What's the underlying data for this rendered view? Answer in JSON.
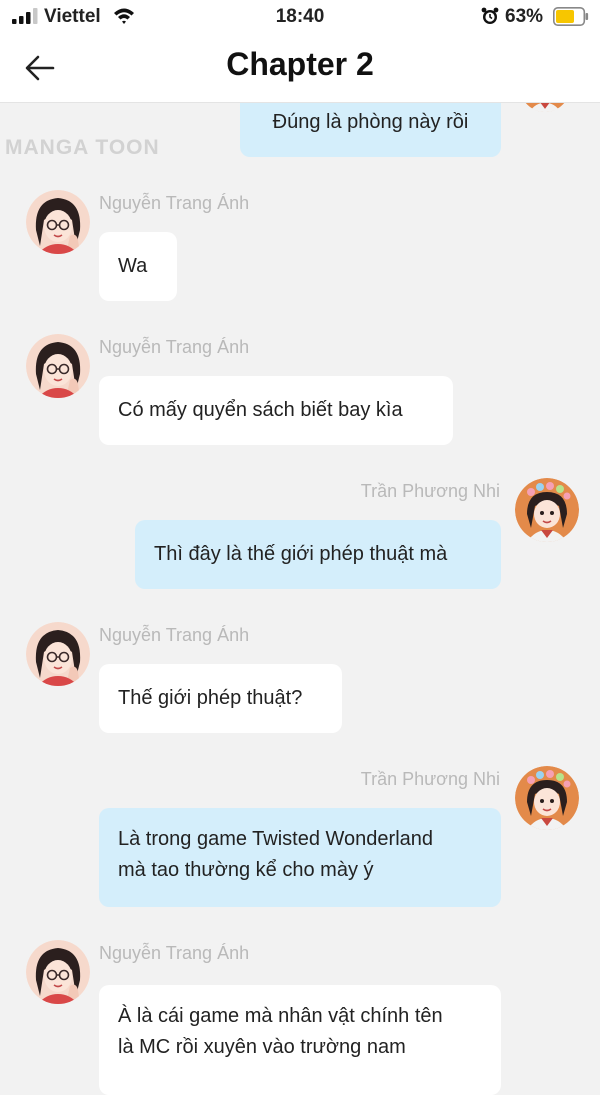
{
  "status": {
    "carrier": "Viettel",
    "time": "18:40",
    "battery": "63%"
  },
  "header": {
    "title": "Chapter 2",
    "back_icon": "arrow-left-icon"
  },
  "watermark": "MANGA TOON",
  "colors": {
    "background": "#f2f2f2",
    "left_bubble": "#ffffff",
    "right_bubble": "#d4eefb",
    "name_text": "#b9b9b9",
    "battery": "#f7c600"
  },
  "messages": [
    {
      "side": "right",
      "name": "",
      "text": "Đúng là phòng này rồi"
    },
    {
      "side": "left",
      "name": "Nguyễn Trang Ánh",
      "text": "Wa"
    },
    {
      "side": "left",
      "name": "Nguyễn Trang Ánh",
      "text": "Có mấy quyển sách biết bay kìa"
    },
    {
      "side": "right",
      "name": "Trần Phương Nhi",
      "text": "Thì đây là thế giới phép thuật mà"
    },
    {
      "side": "left",
      "name": "Nguyễn Trang Ánh",
      "text": "Thế giới phép thuật?"
    },
    {
      "side": "right",
      "name": "Trần Phương Nhi",
      "lines": [
        "Là trong game Twisted Wonderland",
        "mà tao thường kể cho mày ý"
      ]
    },
    {
      "side": "left",
      "name": "Nguyễn Trang Ánh",
      "lines": [
        "À là cái game mà nhân vật chính tên",
        "là MC rồi xuyên vào trường nam"
      ]
    }
  ]
}
